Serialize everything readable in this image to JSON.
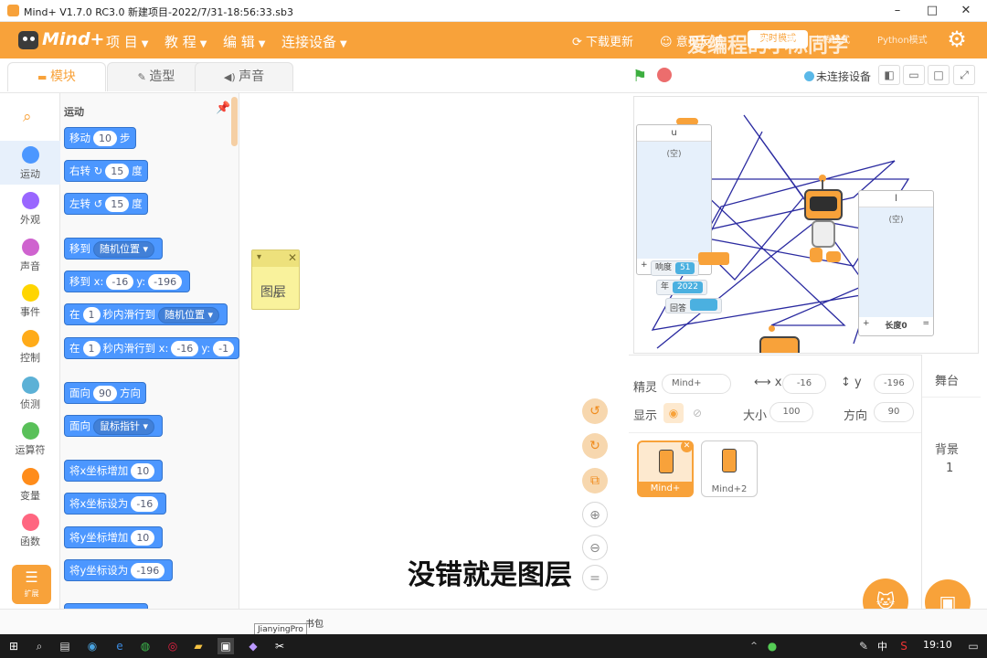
{
  "window": {
    "title": "Mind+ V1.7.0 RC3.0   新建项目-2022/7/31-18:56:33.sb3",
    "minimize": "–",
    "maximize": "□",
    "close": "✕"
  },
  "menubar": {
    "logo": "Mind+",
    "items": [
      {
        "label": "项 目"
      },
      {
        "label": "教 程"
      },
      {
        "label": "编 辑"
      },
      {
        "label": "连接设备"
      }
    ],
    "download_update": "下载更新",
    "feedback": "意见反馈",
    "mode_button": "实时模式",
    "upload_mode": "上传模式",
    "python_mode": "Python模式",
    "watermark": "爱编程的小陈同学"
  },
  "tabs": [
    {
      "label": "模块",
      "active": true
    },
    {
      "label": "造型",
      "active": false
    },
    {
      "label": "声音",
      "active": false
    }
  ],
  "categories": [
    {
      "label": "运动",
      "color": "#4c97ff",
      "active": true
    },
    {
      "label": "外观",
      "color": "#9966ff"
    },
    {
      "label": "声音",
      "color": "#cf63cf"
    },
    {
      "label": "事件",
      "color": "#ffd500"
    },
    {
      "label": "控制",
      "color": "#ffab19"
    },
    {
      "label": "侦测",
      "color": "#5cb1d6"
    },
    {
      "label": "运算符",
      "color": "#59c059"
    },
    {
      "label": "变量",
      "color": "#ff8c1a"
    },
    {
      "label": "函数",
      "color": "#ff6680"
    }
  ],
  "extension_label": "扩展",
  "palette": {
    "header": "运动",
    "blocks": {
      "move": {
        "pre": "移动",
        "val": "10",
        "post": "步"
      },
      "turn_right": {
        "pre": "右转",
        "icon": "↻",
        "val": "15",
        "post": "度"
      },
      "turn_left": {
        "pre": "左转",
        "icon": "↺",
        "val": "15",
        "post": "度"
      },
      "goto": {
        "pre": "移到",
        "drop": "随机位置 ▾"
      },
      "goto_xy": {
        "pre": "移到 x:",
        "x": "-16",
        "mid": "y:",
        "y": "-196"
      },
      "glide": {
        "pre": "在",
        "val": "1",
        "mid": "秒内滑行到",
        "drop": "随机位置 ▾"
      },
      "glide_xy": {
        "pre": "在",
        "val": "1",
        "mid": "秒内滑行到 x:",
        "x": "-16",
        "mid2": "y:",
        "y": "-1"
      },
      "point_dir": {
        "pre": "面向",
        "val": "90",
        "post": "方向"
      },
      "point_towards": {
        "pre": "面向",
        "drop": "鼠标指针 ▾"
      },
      "change_x": {
        "pre": "将x坐标增加",
        "val": "10"
      },
      "set_x": {
        "pre": "将x坐标设为",
        "val": "-16"
      },
      "change_y": {
        "pre": "将y坐标增加",
        "val": "10"
      },
      "set_y": {
        "pre": "将y坐标设为",
        "val": "-196"
      }
    }
  },
  "workspace": {
    "note_text": "图层",
    "subtitle": "没错就是图层"
  },
  "stage_header": {
    "connection": "未连接设备"
  },
  "stage": {
    "list_u": {
      "name": "u",
      "empty": "(空)",
      "add": "+"
    },
    "list_l": {
      "name": "l",
      "empty": "(空)",
      "add": "+",
      "length": "长度0",
      "eq": "="
    },
    "vars": [
      {
        "label": "响度",
        "value": "51"
      },
      {
        "label": "年",
        "value": "2022"
      },
      {
        "label": "回答",
        "value": ""
      }
    ]
  },
  "sprite_info": {
    "sprite_label": "精灵",
    "sprite_name": "Mind+",
    "x_label": "x",
    "x": "-16",
    "y_label": "y",
    "y": "-196",
    "show_label": "显示",
    "size_label": "大小",
    "size": "100",
    "dir_label": "方向",
    "direction": "90"
  },
  "sprites": [
    {
      "name": "Mind+",
      "selected": true
    },
    {
      "name": "Mind+2",
      "selected": false
    }
  ],
  "stage_pane": {
    "title": "舞台",
    "backdrop_label": "背景",
    "backdrop_count": "1"
  },
  "taskbar": {
    "tooltip": "JianyingPro",
    "tray_lang": "中",
    "time": "19:10",
    "peek": "书包"
  }
}
